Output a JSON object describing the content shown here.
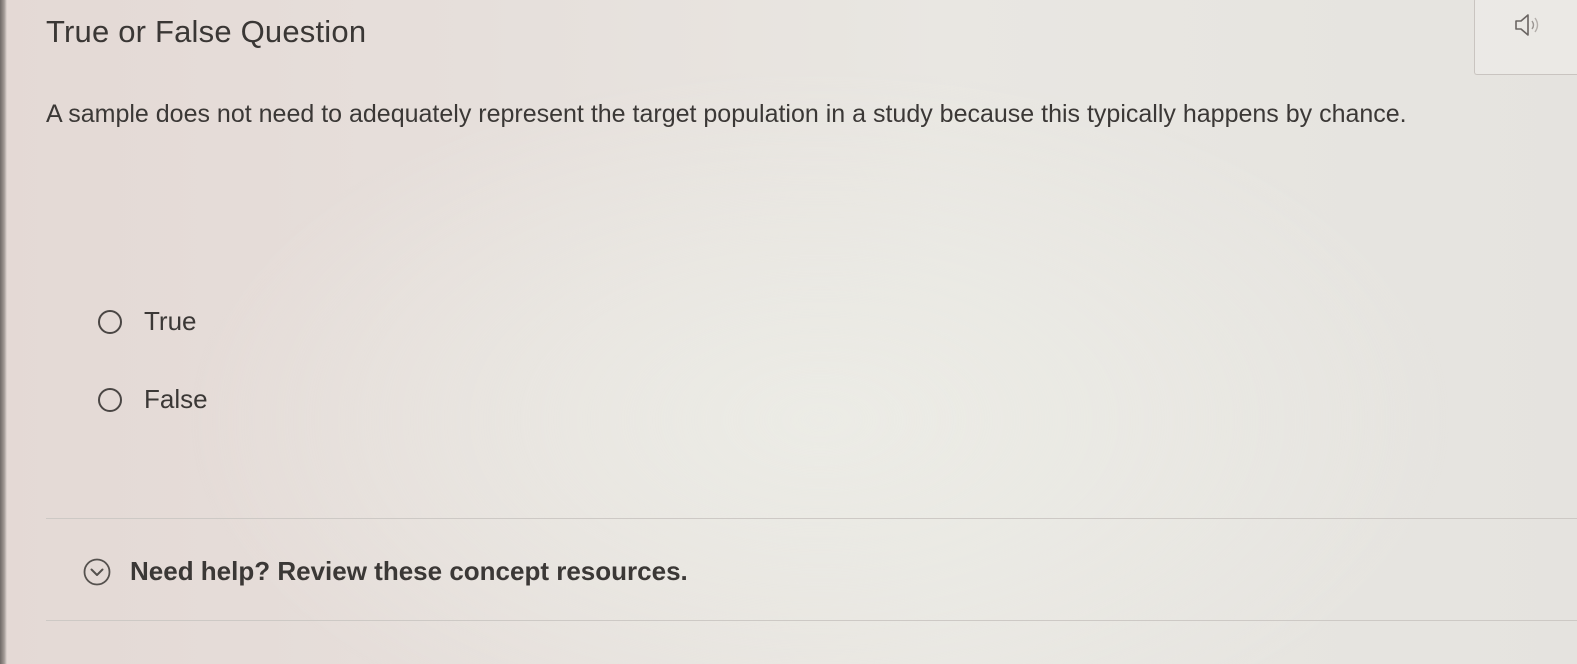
{
  "header": {
    "title": "True or False Question",
    "audio_icon": "speaker-icon"
  },
  "question": {
    "text": "A sample does not need to adequately represent the target population in a study because this typically happens by chance."
  },
  "options": [
    {
      "label": "True",
      "selected": false
    },
    {
      "label": "False",
      "selected": false
    }
  ],
  "help": {
    "icon": "chevron-down-circle-icon",
    "label": "Need help? Review these concept resources."
  }
}
